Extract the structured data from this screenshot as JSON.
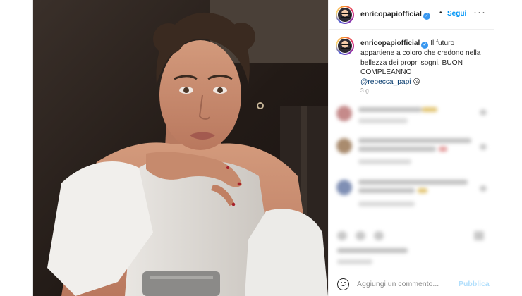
{
  "post": {
    "username": "enricopapiofficial",
    "verified_icon": "verified-badge-icon",
    "separator": "•",
    "follow_label": "Segui",
    "more_label": "···"
  },
  "caption": {
    "username": "enricopapiofficial",
    "text": "Il futuro appartiene a coloro che credono nella bellezza dei propri sogni. BUON COMPLEANNO",
    "mention": "@rebecca_papi",
    "emoji": "😘",
    "time": "3 g"
  },
  "comment_box": {
    "placeholder": "Aggiungi un commento...",
    "publish_label": "Pubblica"
  },
  "colors": {
    "accent": "#0095f6",
    "verified": "#3897f0",
    "publish_disabled": "#b2dffc",
    "text": "#262626",
    "muted": "#8e8e8e"
  }
}
